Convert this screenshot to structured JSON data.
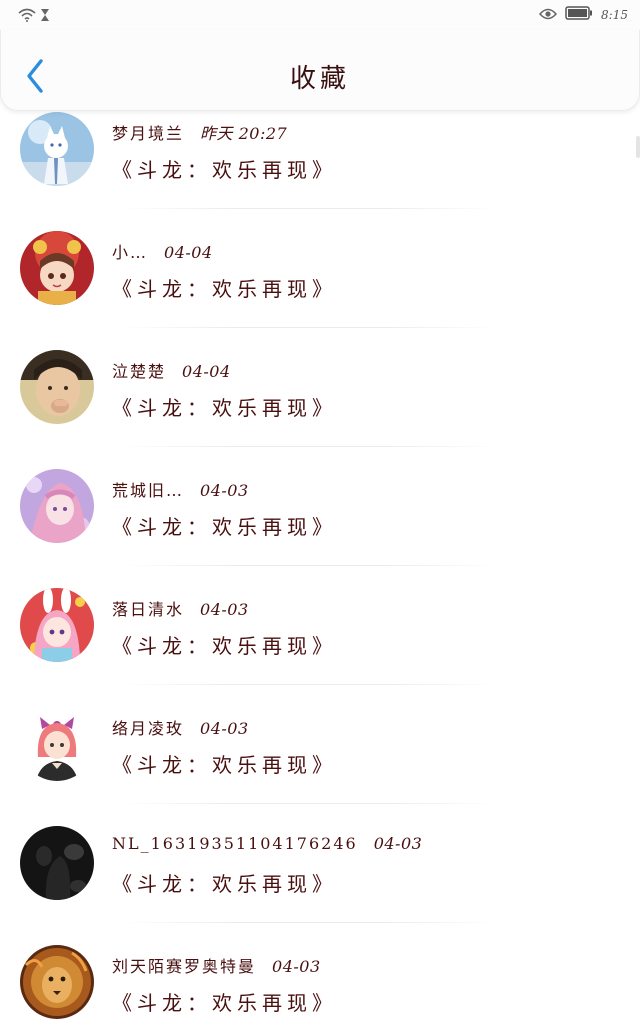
{
  "status_bar": {
    "time": "8:15",
    "left_icons": [
      "wifi-icon",
      "hourglass-icon"
    ],
    "right_icons": [
      "eye-icon",
      "battery-icon"
    ]
  },
  "header": {
    "title": "收藏",
    "back_icon": "chevron-left-icon",
    "accent_color": "#2a8de0"
  },
  "favorites": [
    {
      "author": "梦月境兰",
      "time": "昨天 20:27",
      "title": "《斗龙：欢乐再现》",
      "avatar": "avatar-white-cat-character"
    },
    {
      "author": "小…",
      "time": "04-04",
      "title": "《斗龙：欢乐再现》",
      "avatar": "avatar-lion-dance-girl"
    },
    {
      "author": "泣楚楚",
      "time": "04-04",
      "title": "《斗龙：欢乐再现》",
      "avatar": "avatar-photo-girl"
    },
    {
      "author": "荒城旧…",
      "time": "04-03",
      "title": "《斗龙：欢乐再现》",
      "avatar": "avatar-purple-anime-girl"
    },
    {
      "author": "落日清水",
      "time": "04-03",
      "title": "《斗龙：欢乐再现》",
      "avatar": "avatar-bunny-ears-girl"
    },
    {
      "author": "络月凌玫",
      "time": "04-03",
      "title": "《斗龙：欢乐再现》",
      "avatar": "avatar-pink-hair-chibi"
    },
    {
      "author": "NL_16319351104176246",
      "time": "04-03",
      "title": "《斗龙：欢乐再现》",
      "avatar": "avatar-dark-silhouette"
    },
    {
      "author": "刘天陌赛罗奥特曼",
      "time": "04-03",
      "title": "《斗龙：欢乐再现》",
      "avatar": "avatar-lion"
    }
  ]
}
